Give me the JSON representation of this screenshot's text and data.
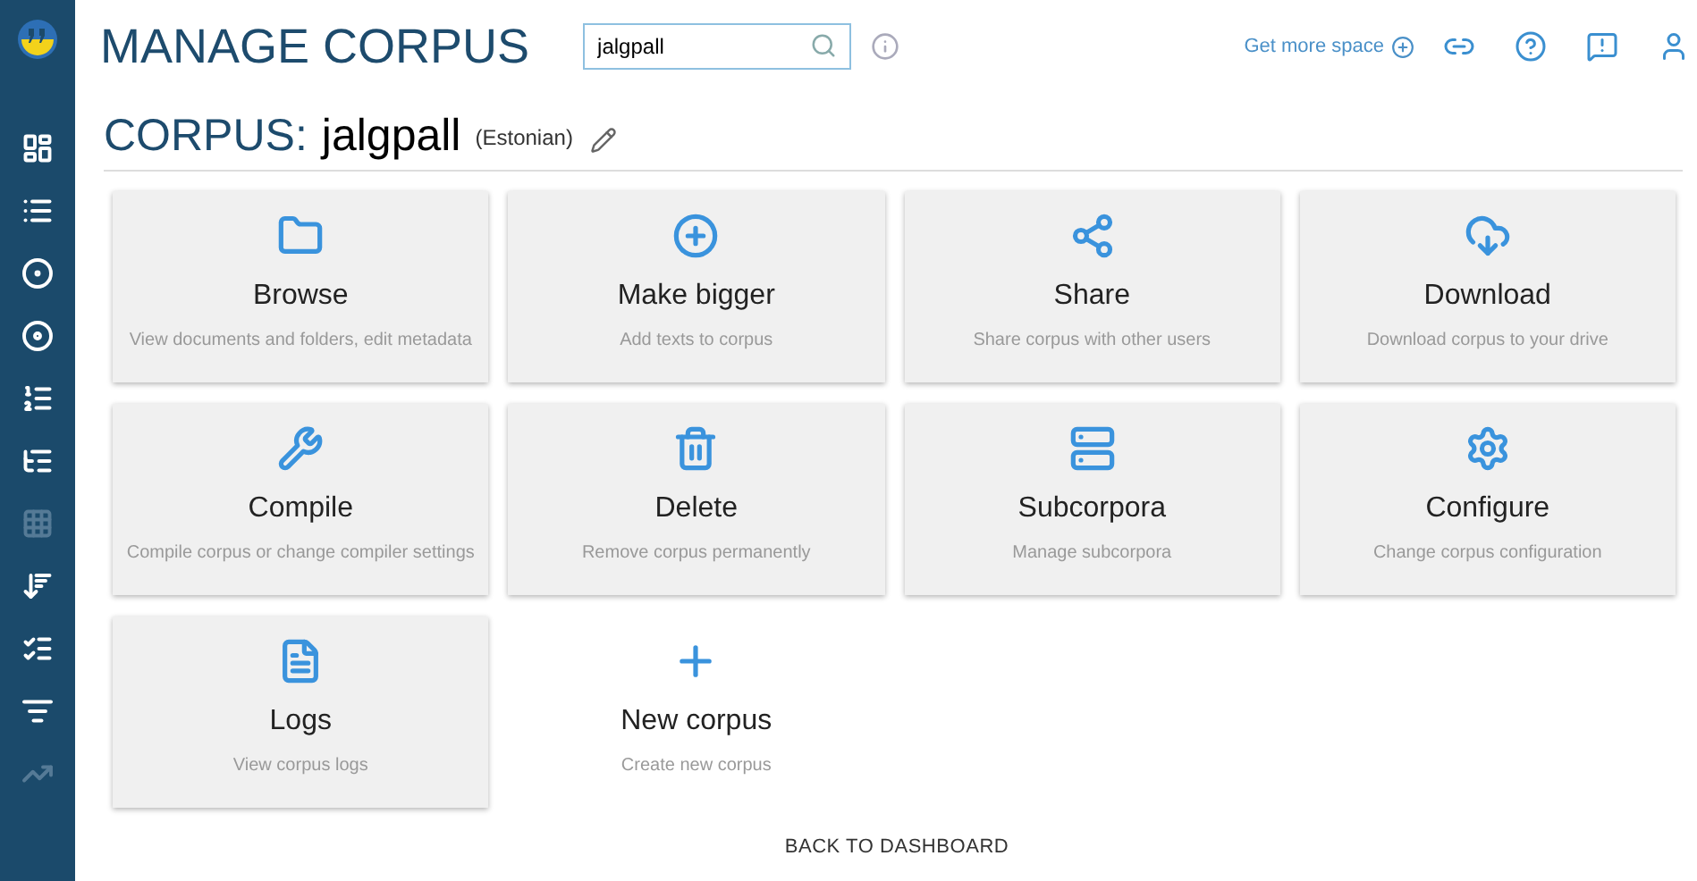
{
  "header": {
    "title": "MANAGE CORPUS",
    "search": {
      "value": "jalgpall"
    },
    "get_more_space": "Get more space"
  },
  "sidebar": {
    "items": [
      {
        "disabled": false
      },
      {
        "disabled": false
      },
      {
        "disabled": false
      },
      {
        "disabled": false
      },
      {
        "disabled": false
      },
      {
        "disabled": false
      },
      {
        "disabled": true
      },
      {
        "disabled": false
      },
      {
        "disabled": false
      },
      {
        "disabled": false
      },
      {
        "disabled": true
      }
    ]
  },
  "corpus": {
    "label": "CORPUS:",
    "name": "jalgpall",
    "language": "(Estonian)"
  },
  "tiles": [
    {
      "kind": "card",
      "title": "Browse",
      "description": "View documents and folders, edit metadata"
    },
    {
      "kind": "card",
      "title": "Make bigger",
      "description": "Add texts to corpus"
    },
    {
      "kind": "card",
      "title": "Share",
      "description": "Share corpus with other users"
    },
    {
      "kind": "card",
      "title": "Download",
      "description": "Download corpus to your drive"
    },
    {
      "kind": "card",
      "title": "Compile",
      "description": "Compile corpus or change compiler settings"
    },
    {
      "kind": "card",
      "title": "Delete",
      "description": "Remove corpus permanently"
    },
    {
      "kind": "card",
      "title": "Subcorpora",
      "description": "Manage subcorpora"
    },
    {
      "kind": "card",
      "title": "Configure",
      "description": "Change corpus configuration"
    },
    {
      "kind": "card",
      "title": "Logs",
      "description": "View corpus logs"
    },
    {
      "kind": "flat",
      "title": "New corpus",
      "description": "Create new corpus"
    }
  ],
  "back_link": "BACK TO DASHBOARD"
}
